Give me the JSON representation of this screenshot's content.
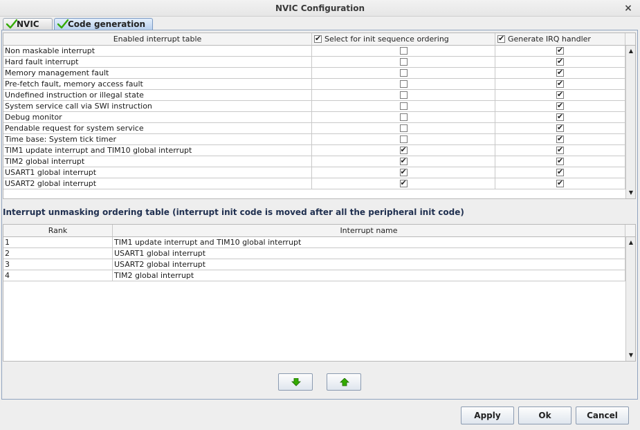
{
  "window": {
    "title": "NVIC Configuration",
    "close_glyph": "×"
  },
  "tabs": [
    {
      "label": "NVIC",
      "active": false,
      "icon": "check-icon"
    },
    {
      "label": "Code generation",
      "active": true,
      "icon": "check-icon"
    }
  ],
  "enabled_table": {
    "columns": [
      "Enabled interrupt table",
      "Select for init sequence ordering",
      "Generate IRQ handler"
    ],
    "header_checks": [
      true,
      true
    ],
    "rows": [
      {
        "name": "Non maskable interrupt",
        "init_order": false,
        "irq_handler": true
      },
      {
        "name": "Hard fault interrupt",
        "init_order": false,
        "irq_handler": true
      },
      {
        "name": "Memory management fault",
        "init_order": false,
        "irq_handler": true
      },
      {
        "name": "Pre-fetch fault, memory access fault",
        "init_order": false,
        "irq_handler": true
      },
      {
        "name": "Undefined instruction or illegal state",
        "init_order": false,
        "irq_handler": true
      },
      {
        "name": "System service call via SWI instruction",
        "init_order": false,
        "irq_handler": true
      },
      {
        "name": "Debug monitor",
        "init_order": false,
        "irq_handler": true
      },
      {
        "name": "Pendable request for system service",
        "init_order": false,
        "irq_handler": true
      },
      {
        "name": "Time base: System tick timer",
        "init_order": false,
        "irq_handler": true
      },
      {
        "name": "TIM1 update interrupt and TIM10 global interrupt",
        "init_order": true,
        "irq_handler": true
      },
      {
        "name": "TIM2 global interrupt",
        "init_order": true,
        "irq_handler": true
      },
      {
        "name": "USART1 global interrupt",
        "init_order": true,
        "irq_handler": true
      },
      {
        "name": "USART2 global interrupt",
        "init_order": true,
        "irq_handler": true
      }
    ]
  },
  "ordering_section": {
    "title": "Interrupt unmasking ordering table (interrupt init code is moved after all the peripheral init code)"
  },
  "ordering_table": {
    "columns": [
      "Rank",
      "Interrupt name"
    ],
    "rows": [
      {
        "rank": "1",
        "name": "TIM1 update interrupt and TIM10 global interrupt"
      },
      {
        "rank": "2",
        "name": "USART1 global interrupt"
      },
      {
        "rank": "3",
        "name": "USART2 global interrupt"
      },
      {
        "rank": "4",
        "name": "TIM2 global interrupt"
      }
    ]
  },
  "move_buttons": {
    "down_icon": "arrow-down-icon",
    "up_icon": "arrow-up-icon",
    "color": "#33aa00"
  },
  "buttons": {
    "apply": "Apply",
    "ok": "Ok",
    "cancel": "Cancel"
  },
  "colors": {
    "check_green": "#33aa00",
    "section_title": "#203050"
  }
}
